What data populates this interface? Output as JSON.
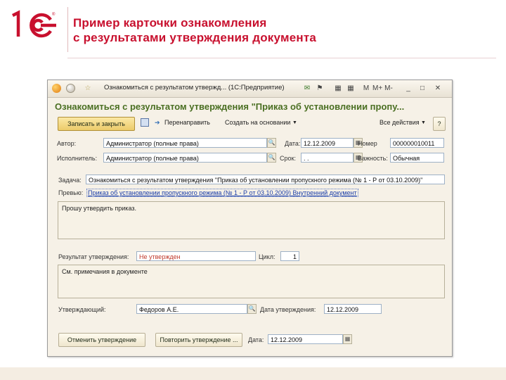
{
  "slide": {
    "title_line1": "Пример карточки ознакомления",
    "title_line2": "с результатами утверждения документа",
    "brand_color": "#c8102e"
  },
  "window": {
    "title": "Ознакомиться с результатом утвержд... (1С:Предприятие)",
    "heading": "Ознакомиться с результатом утверждения \"Приказ об установлении пропу...",
    "title_buttons": [
      "✉",
      "⚑",
      "▦",
      "▦",
      "M",
      "M+",
      "M-",
      "_",
      "□",
      "✕"
    ]
  },
  "toolbar": {
    "save_close": "Записать и закрыть",
    "redirect": "Перенаправить",
    "create_based": "Создать на основании",
    "all_actions": "Все действия",
    "help": "?"
  },
  "fields": {
    "author_label": "Автор:",
    "author_value": "Администратор (полные права)",
    "executor_label": "Исполнитель:",
    "executor_value": "Администратор (полные права)",
    "date_label": "Дата:",
    "date_value": "12.12.2009",
    "deadline_label": "Срок:",
    "deadline_value": ".  .",
    "number_label": "Номер",
    "number_value": "000000010011",
    "importance_label": "Важность:",
    "importance_value": "Обычная",
    "task_label": "Задача:",
    "task_value": "Ознакомиться с результатом утверждения \"Приказ об установлении пропускного режима (№ 1 - Р от 03.10.2009)\"",
    "preview_label": "Превью:",
    "preview_value": "Приказ об установлении пропускного режима (№ 1 - Р от 03.10.2009) Внутренний документ",
    "description": "Прошу утвердить приказ.",
    "result_label": "Результат утверждения:",
    "result_value": "Не утвержден",
    "cycle_label": "Цикл:",
    "cycle_value": "1",
    "comment": "См. примечания в документе",
    "approver_label": "Утверждающий:",
    "approver_value": "Федоров А.Е.",
    "approval_date_label": "Дата утверждения:",
    "approval_date_value": "12.12.2009"
  },
  "bottom": {
    "cancel_approval": "Отменить утверждение",
    "repeat_approval": "Повторить утверждение ...",
    "date_label": "Дата:",
    "date_value": "12.12.2009"
  }
}
